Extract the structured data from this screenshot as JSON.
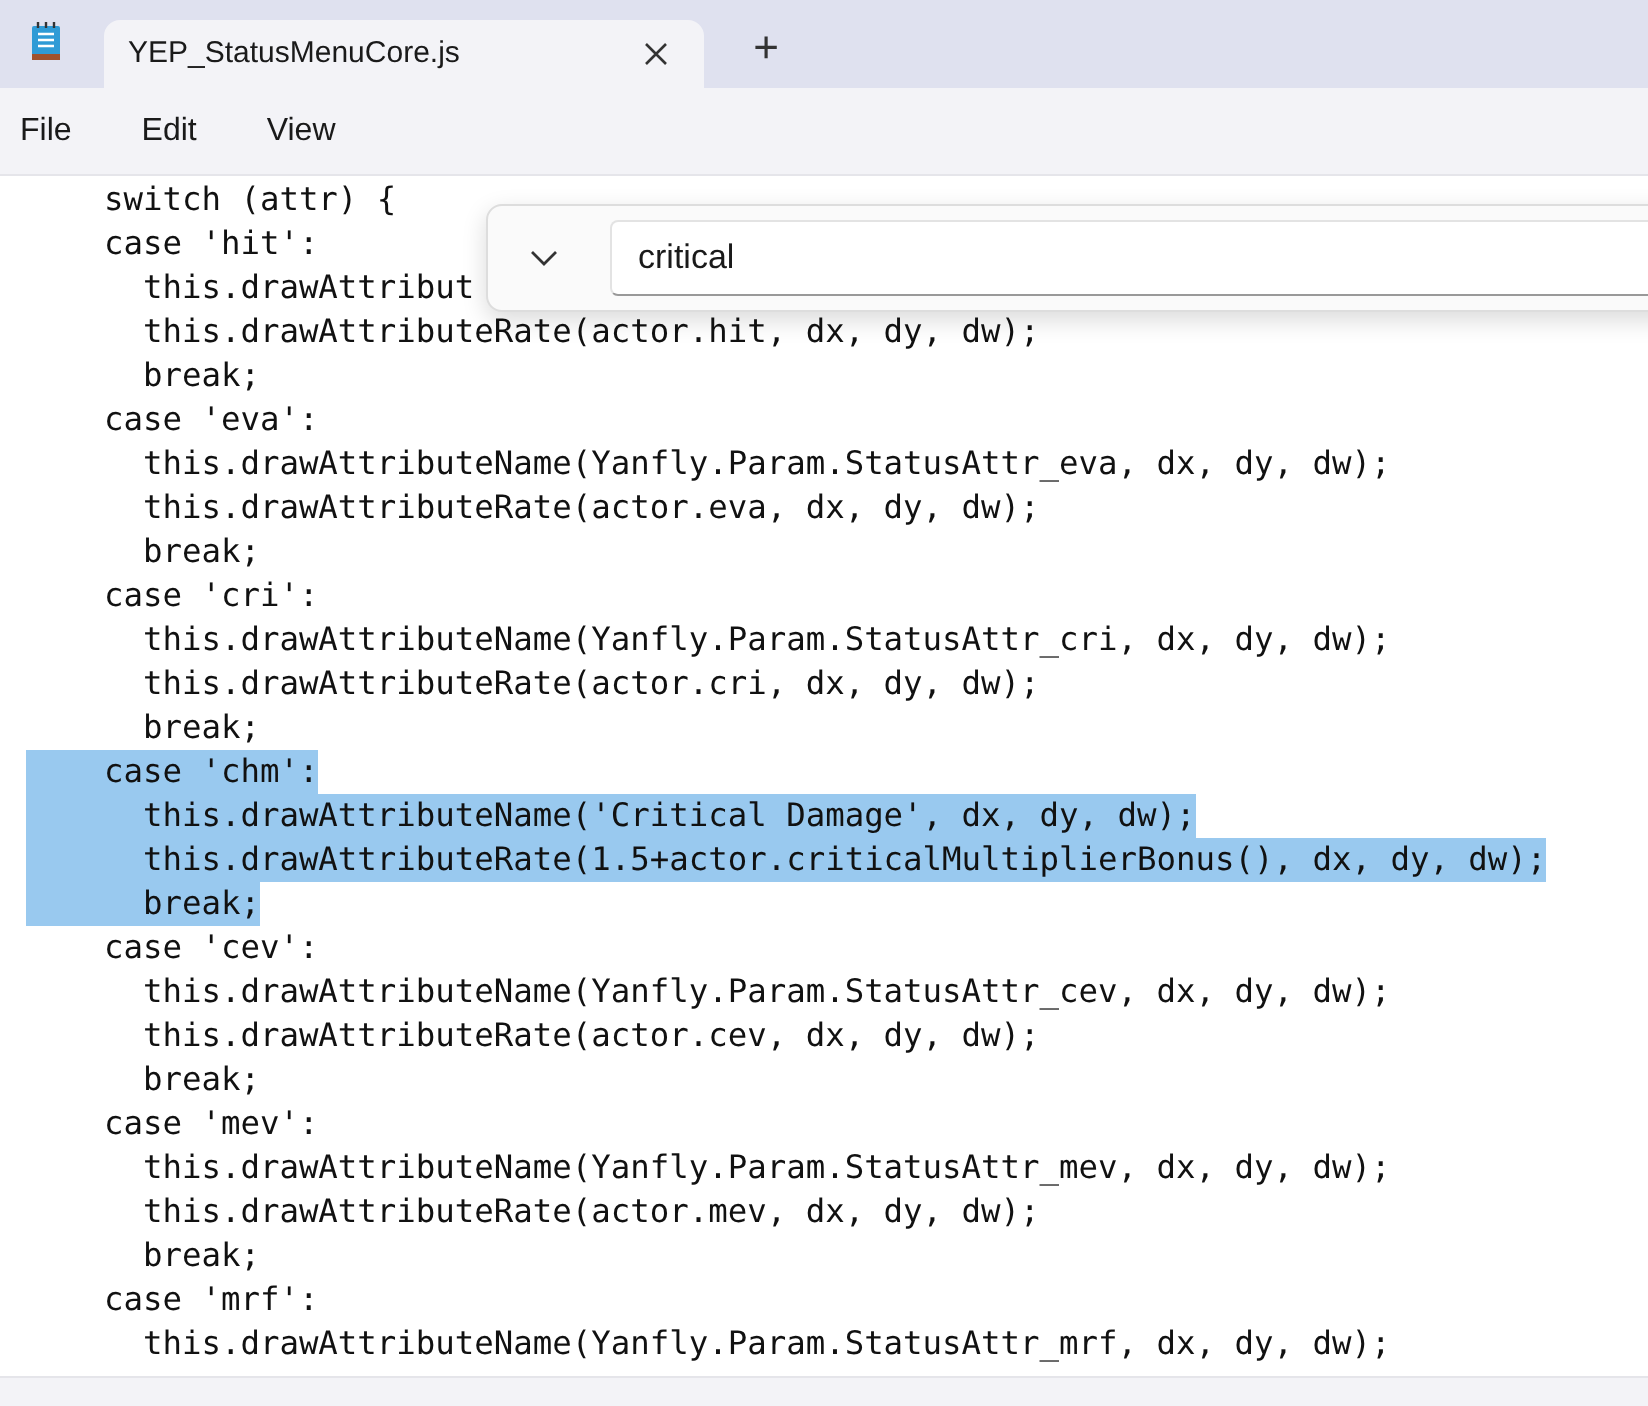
{
  "tabs": [
    {
      "title": "YEP_StatusMenuCore.js",
      "selected": true
    }
  ],
  "new_tab": "+",
  "menu": [
    "File",
    "Edit",
    "View"
  ],
  "find": {
    "value": "critical"
  },
  "lines": [
    {
      "text": "    switch (attr) {",
      "selected": false
    },
    {
      "text": "    case 'hit':",
      "selected": false
    },
    {
      "text": "      this.drawAttribut",
      "selected": false
    },
    {
      "text": "      this.drawAttributeRate(actor.hit, dx, dy, dw);",
      "selected": false
    },
    {
      "text": "      break;",
      "selected": false
    },
    {
      "text": "    case 'eva':",
      "selected": false
    },
    {
      "text": "      this.drawAttributeName(Yanfly.Param.StatusAttr_eva, dx, dy, dw);",
      "selected": false
    },
    {
      "text": "      this.drawAttributeRate(actor.eva, dx, dy, dw);",
      "selected": false
    },
    {
      "text": "      break;",
      "selected": false
    },
    {
      "text": "    case 'cri':",
      "selected": false
    },
    {
      "text": "      this.drawAttributeName(Yanfly.Param.StatusAttr_cri, dx, dy, dw);",
      "selected": false
    },
    {
      "text": "      this.drawAttributeRate(actor.cri, dx, dy, dw);",
      "selected": false
    },
    {
      "text": "      break;",
      "selected": false
    },
    {
      "text": "    case 'chm':",
      "selected": true
    },
    {
      "text": "      this.drawAttributeName('Critical Damage', dx, dy, dw);",
      "selected": true
    },
    {
      "text": "      this.drawAttributeRate(1.5+actor.criticalMultiplierBonus(), dx, dy, dw);",
      "selected": true
    },
    {
      "text": "      break;",
      "selected": true
    },
    {
      "text": "    case 'cev':",
      "selected": false
    },
    {
      "text": "      this.drawAttributeName(Yanfly.Param.StatusAttr_cev, dx, dy, dw);",
      "selected": false
    },
    {
      "text": "      this.drawAttributeRate(actor.cev, dx, dy, dw);",
      "selected": false
    },
    {
      "text": "      break;",
      "selected": false
    },
    {
      "text": "    case 'mev':",
      "selected": false
    },
    {
      "text": "      this.drawAttributeName(Yanfly.Param.StatusAttr_mev, dx, dy, dw);",
      "selected": false
    },
    {
      "text": "      this.drawAttributeRate(actor.mev, dx, dy, dw);",
      "selected": false
    },
    {
      "text": "      break;",
      "selected": false
    },
    {
      "text": "    case 'mrf':",
      "selected": false
    },
    {
      "text": "      this.drawAttributeName(Yanfly.Param.StatusAttr_mrf, dx, dy, dw);",
      "selected": false
    }
  ]
}
